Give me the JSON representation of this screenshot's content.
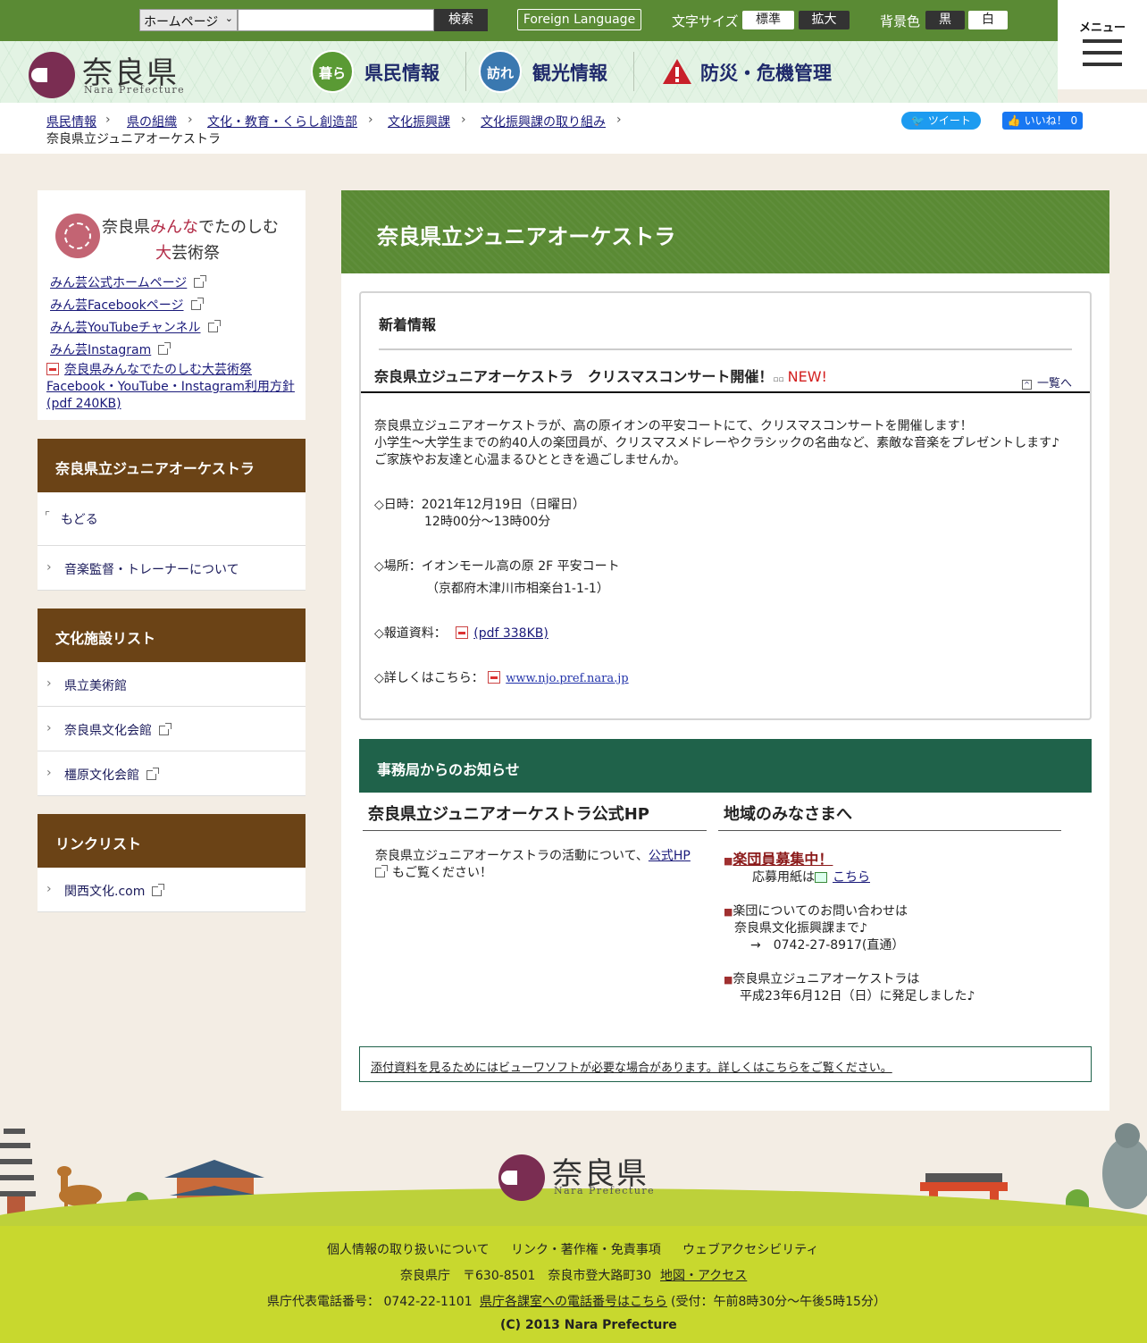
{
  "topbar": {
    "search_scope": "ホームページ",
    "search_placeholder": "",
    "search_button": "検索",
    "foreign_language": "Foreign Language",
    "font_size_label": "文字サイズ",
    "font_standard": "標準",
    "font_large": "拡大",
    "bg_color_label": "背景色",
    "bg_black": "黒",
    "bg_white": "白",
    "menu_label": "メニュー"
  },
  "logo": {
    "name": "奈良県",
    "sub": "Nara Prefecture"
  },
  "nav": [
    {
      "badge": "暮らす",
      "label": "県民情報",
      "color": "#5a9a34"
    },
    {
      "badge": "訪れる",
      "label": "観光情報",
      "color": "#3a78b0"
    },
    {
      "badge": "!",
      "label": "防災・危機管理",
      "color": "#c8202a"
    }
  ],
  "breadcrumb": [
    "県民情報",
    "県の組織",
    "文化・教育・くらし創造部",
    "文化振興課",
    "文化振興課の取り組み"
  ],
  "breadcrumb_current": "奈良県立ジュニアオーケストラ",
  "social": {
    "tweet": "ツイート",
    "like": "いいね！ 0"
  },
  "sidebar": {
    "minge": {
      "brand_line1_a": "奈良県",
      "brand_line1_b": "みんな",
      "brand_line1_c": "でたのしむ",
      "brand_line2_a": "大",
      "brand_line2_b": "芸術祭",
      "links": [
        "みん芸公式ホームページ",
        "みん芸Facebookページ",
        "みん芸YouTubeチャンネル",
        "みん芸Instagram"
      ],
      "pdf_line1": "奈良県みんなでたのしむ大芸術祭",
      "pdf_line2": "Facebook・YouTube・Instagram利用方針",
      "pdf_line3": "(pdf 240KB)"
    },
    "section1": {
      "title": "奈良県立ジュニアオーケストラ",
      "back": "もどる",
      "items": [
        "音楽監督・トレーナーについて"
      ]
    },
    "section2": {
      "title": "文化施設リスト",
      "items": [
        "県立美術館",
        "奈良県文化会館",
        "橿原文化会館"
      ]
    },
    "section3": {
      "title": "リンクリスト",
      "items": [
        "関西文化.com"
      ]
    }
  },
  "main": {
    "title": "奈良県立ジュニアオーケストラ",
    "news": {
      "heading": "新着情報",
      "item_title": "奈良県立ジュニアオーケストラ　クリスマスコンサート開催！",
      "new_badge": "NEW!",
      "more": "一覧へ",
      "p1": "奈良県立ジュニアオーケストラが、高の原イオンの平安コートにて、クリスマスコンサートを開催します！",
      "p2": "小学生～大学生までの約40人の楽団員が、クリスマスメドレーやクラシックの名曲など、素敵な音楽をプレゼントします♪",
      "p3": "ご家族やお友達と心温まるひとときを過ごしませんか。",
      "date_label": "◇日時：2021年12月19日（日曜日）",
      "time": "12時00分～13時00分",
      "place_label": "◇場所：イオンモール高の原  2F 平安コート",
      "address": "（京都府木津川市相楽台1-1-1）",
      "press_label": "◇報道資料：",
      "press_link": "(pdf 338KB)",
      "detail_label": "◇詳しくはこちら：",
      "detail_link": "www.njo.pref.nara.jp"
    },
    "notice": {
      "heading": "事務局からのお知らせ",
      "left_title": "奈良県立ジュニアオーケストラ公式HP",
      "left_text_a": "奈良県立ジュニアオーケストラの活動について、",
      "left_link": "公式HP",
      "left_text_b": "もご覧ください！",
      "right_title": "地域のみなさまへ",
      "recruit": "楽団員募集中！",
      "form_label": "応募用紙は",
      "form_link": "こちら",
      "contact1": "楽団についてのお問い合わせは",
      "contact2": "奈良県文化振興課まで♪",
      "contact3": "→　0742-27-8917(直通）",
      "founded1": "奈良県立ジュニアオーケストラは",
      "founded2": "平成23年6月12日（日）に発足しました♪"
    },
    "viewer_note": "添付資料を見るためにはビューワソフトが必要な場合があります。詳しくはこちらをご覧ください。"
  },
  "footer": {
    "links": [
      "個人情報の取り扱いについて",
      "リンク・著作権・免責事項",
      "ウェブアクセシビリティ"
    ],
    "address": "奈良県庁　〒630-8501　奈良市登大路町30",
    "map_link": "地図・アクセス",
    "phone_label": "県庁代表電話番号：  0742-22-1101",
    "phone_link": "県庁各課室への電話番号はこちら",
    "hours": "(受付：午前8時30分～午後5時15分）",
    "copyright": "(C) 2013 Nara Prefecture"
  },
  "colors": {
    "topbar_green": "#5a8a34",
    "sidebar_brown": "#6b4316",
    "notice_green": "#1f624a",
    "footer_lime": "#c8d82e",
    "new_red": "#d32020"
  }
}
